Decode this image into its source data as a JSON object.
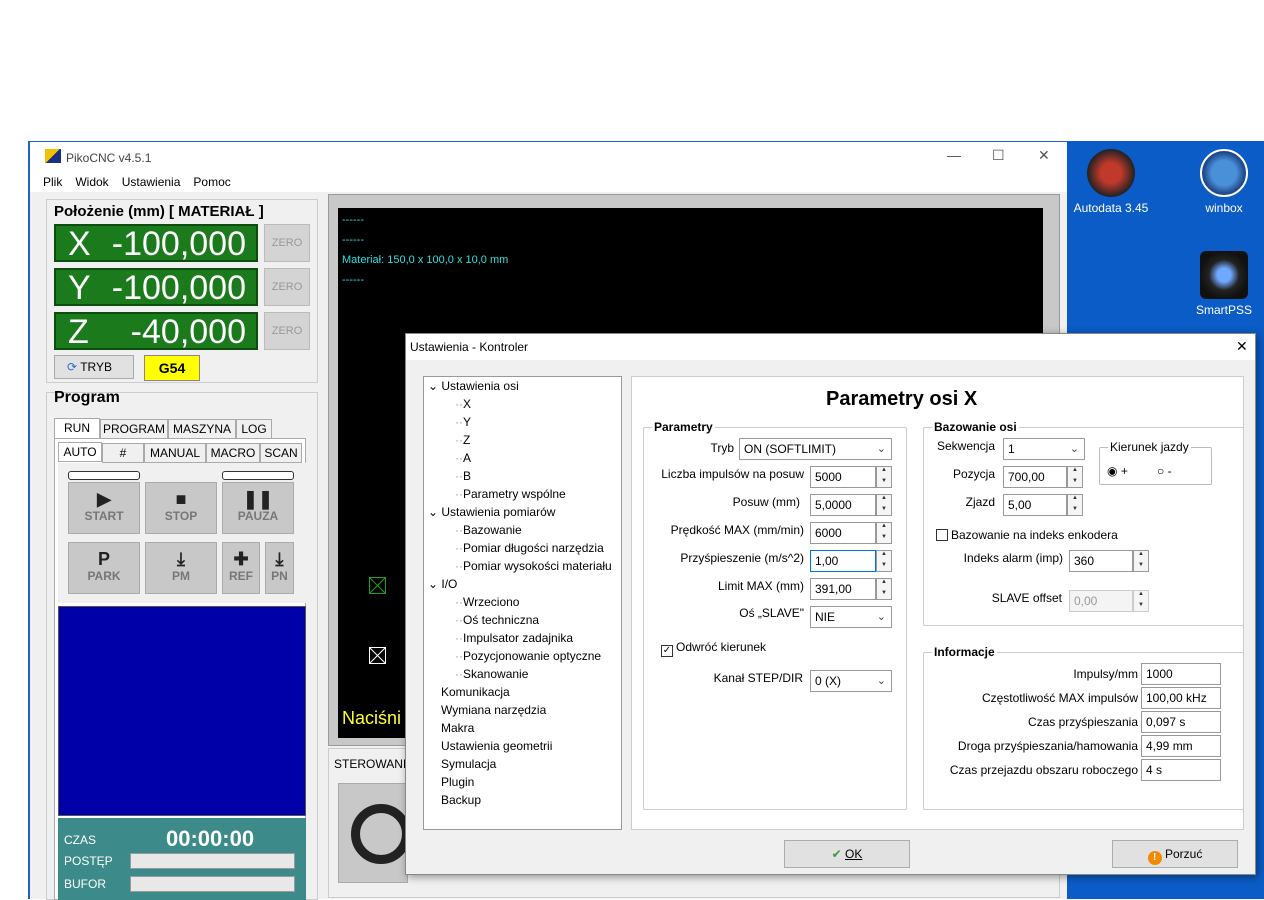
{
  "desktop": {
    "icons": [
      {
        "label": "Autodata 3.45",
        "icon": "autodata-icon"
      },
      {
        "label": "winbox",
        "icon": "winbox-icon"
      },
      {
        "label": "SmartPSS",
        "icon": "smartpss-icon"
      }
    ]
  },
  "window": {
    "title": "PikoCNC v4.5.1",
    "controls": {
      "minimize": "—",
      "maximize": "☐",
      "close": "✕"
    }
  },
  "menu": [
    "Plik",
    "Widok",
    "Ustawienia",
    "Pomoc"
  ],
  "position": {
    "title": "Położenie (mm) [ MATERIAŁ ]",
    "axes": [
      {
        "letter": "X",
        "value": "-100,000",
        "zero": "ZERO"
      },
      {
        "letter": "Y",
        "value": "-100,000",
        "zero": "ZERO"
      },
      {
        "letter": "Z",
        "value": "-40,000",
        "zero": "ZERO"
      }
    ],
    "mode_button": "TRYB",
    "coord_system": "G54"
  },
  "program": {
    "title": "Program",
    "tabs": [
      "RUN",
      "PROGRAM",
      "MASZYNA",
      "LOG"
    ],
    "subtabs": [
      "AUTO",
      "#",
      "MANUAL",
      "MACRO",
      "SCAN"
    ],
    "buttons": [
      {
        "label": "START",
        "icon": "▶"
      },
      {
        "label": "STOP",
        "icon": "■"
      },
      {
        "label": "PAUZA",
        "icon": "❚❚"
      },
      {
        "label": "PARK",
        "icon": "P"
      },
      {
        "label": "PM",
        "icon": "⤓"
      },
      {
        "label": "REF",
        "icon": "✚"
      },
      {
        "label": "PN",
        "icon": "⤓"
      }
    ],
    "time_label": "CZAS",
    "time_value": "00:00:00",
    "progress_label": "POSTĘP",
    "buffer_label": "BUFOR"
  },
  "viewport": {
    "lines": [
      "------",
      "------",
      "Materiał: 150,0 x 100,0 x 10,0 mm",
      "------"
    ],
    "hint": "Naciśni",
    "sterowanie": "STEROWANI"
  },
  "dialog": {
    "title": "Ustawienia - Kontroler",
    "close": "✕",
    "tree": [
      {
        "label": "Ustawienia osi",
        "level": 0,
        "expanded": true
      },
      {
        "label": "X",
        "level": 1
      },
      {
        "label": "Y",
        "level": 1
      },
      {
        "label": "Z",
        "level": 1
      },
      {
        "label": "A",
        "level": 1
      },
      {
        "label": "B",
        "level": 1
      },
      {
        "label": "Parametry wspólne",
        "level": 1
      },
      {
        "label": "Ustawienia pomiarów",
        "level": 0,
        "expanded": true
      },
      {
        "label": "Bazowanie",
        "level": 1
      },
      {
        "label": "Pomiar długości narzędzia",
        "level": 1
      },
      {
        "label": "Pomiar wysokości materiału",
        "level": 1
      },
      {
        "label": "I/O",
        "level": 0,
        "expanded": true
      },
      {
        "label": "Wrzeciono",
        "level": 1
      },
      {
        "label": "Oś techniczna",
        "level": 1
      },
      {
        "label": "Impulsator zadajnika",
        "level": 1
      },
      {
        "label": "Pozycjonowanie optyczne",
        "level": 1
      },
      {
        "label": "Skanowanie",
        "level": 1
      },
      {
        "label": "Komunikacja",
        "level": 0
      },
      {
        "label": "Wymiana narzędzia",
        "level": 0
      },
      {
        "label": "Makra",
        "level": 0
      },
      {
        "label": "Ustawienia geometrii",
        "level": 0
      },
      {
        "label": "Symulacja",
        "level": 0
      },
      {
        "label": "Plugin",
        "level": 0
      },
      {
        "label": "Backup",
        "level": 0
      }
    ],
    "heading": "Parametry osi X",
    "params": {
      "title": "Parametry",
      "tryb_label": "Tryb",
      "tryb_value": "ON (SOFTLIMIT)",
      "impulses_label": "Liczba impulsów na posuw",
      "impulses_value": "5000",
      "feed_label": "Posuw (mm)",
      "feed_value": "5,0000",
      "vmax_label": "Prędkość MAX (mm/min)",
      "vmax_value": "6000",
      "accel_label": "Przyśpieszenie (m/s^2)",
      "accel_value": "1,00",
      "limit_label": "Limit MAX (mm)",
      "limit_value": "391,00",
      "slave_label": "Oś „SLAVE\"",
      "slave_value": "NIE",
      "invert_label": "Odwróć kierunek",
      "invert_checked": true,
      "channel_label": "Kanał STEP/DIR",
      "channel_value": "0 (X)"
    },
    "homing": {
      "title": "Bazowanie osi",
      "seq_label": "Sekwencja",
      "seq_value": "1",
      "pos_label": "Pozycja",
      "pos_value": "700,00",
      "exit_label": "Zjazd",
      "exit_value": "5,00",
      "dir_title": "Kierunek jazdy",
      "dir_plus": "+",
      "dir_minus": "-",
      "encoder_label": "Bazowanie na indeks enkodera",
      "encoder_checked": false,
      "index_alarm_label": "Indeks alarm (imp)",
      "index_alarm_value": "360",
      "slave_offset_label": "SLAVE offset",
      "slave_offset_value": "0,00"
    },
    "info": {
      "title": "Informacje",
      "rows": [
        {
          "label": "Impulsy/mm",
          "value": "1000"
        },
        {
          "label": "Częstotliwość MAX impulsów",
          "value": "100,00 kHz"
        },
        {
          "label": "Czas przyśpieszania",
          "value": "0,097 s"
        },
        {
          "label": "Droga przyśpieszania/hamowania",
          "value": "4,99 mm"
        },
        {
          "label": "Czas przejazdu obszaru roboczego",
          "value": "4 s"
        }
      ]
    },
    "ok_label": "OK",
    "cancel_label": "Porzuć"
  }
}
